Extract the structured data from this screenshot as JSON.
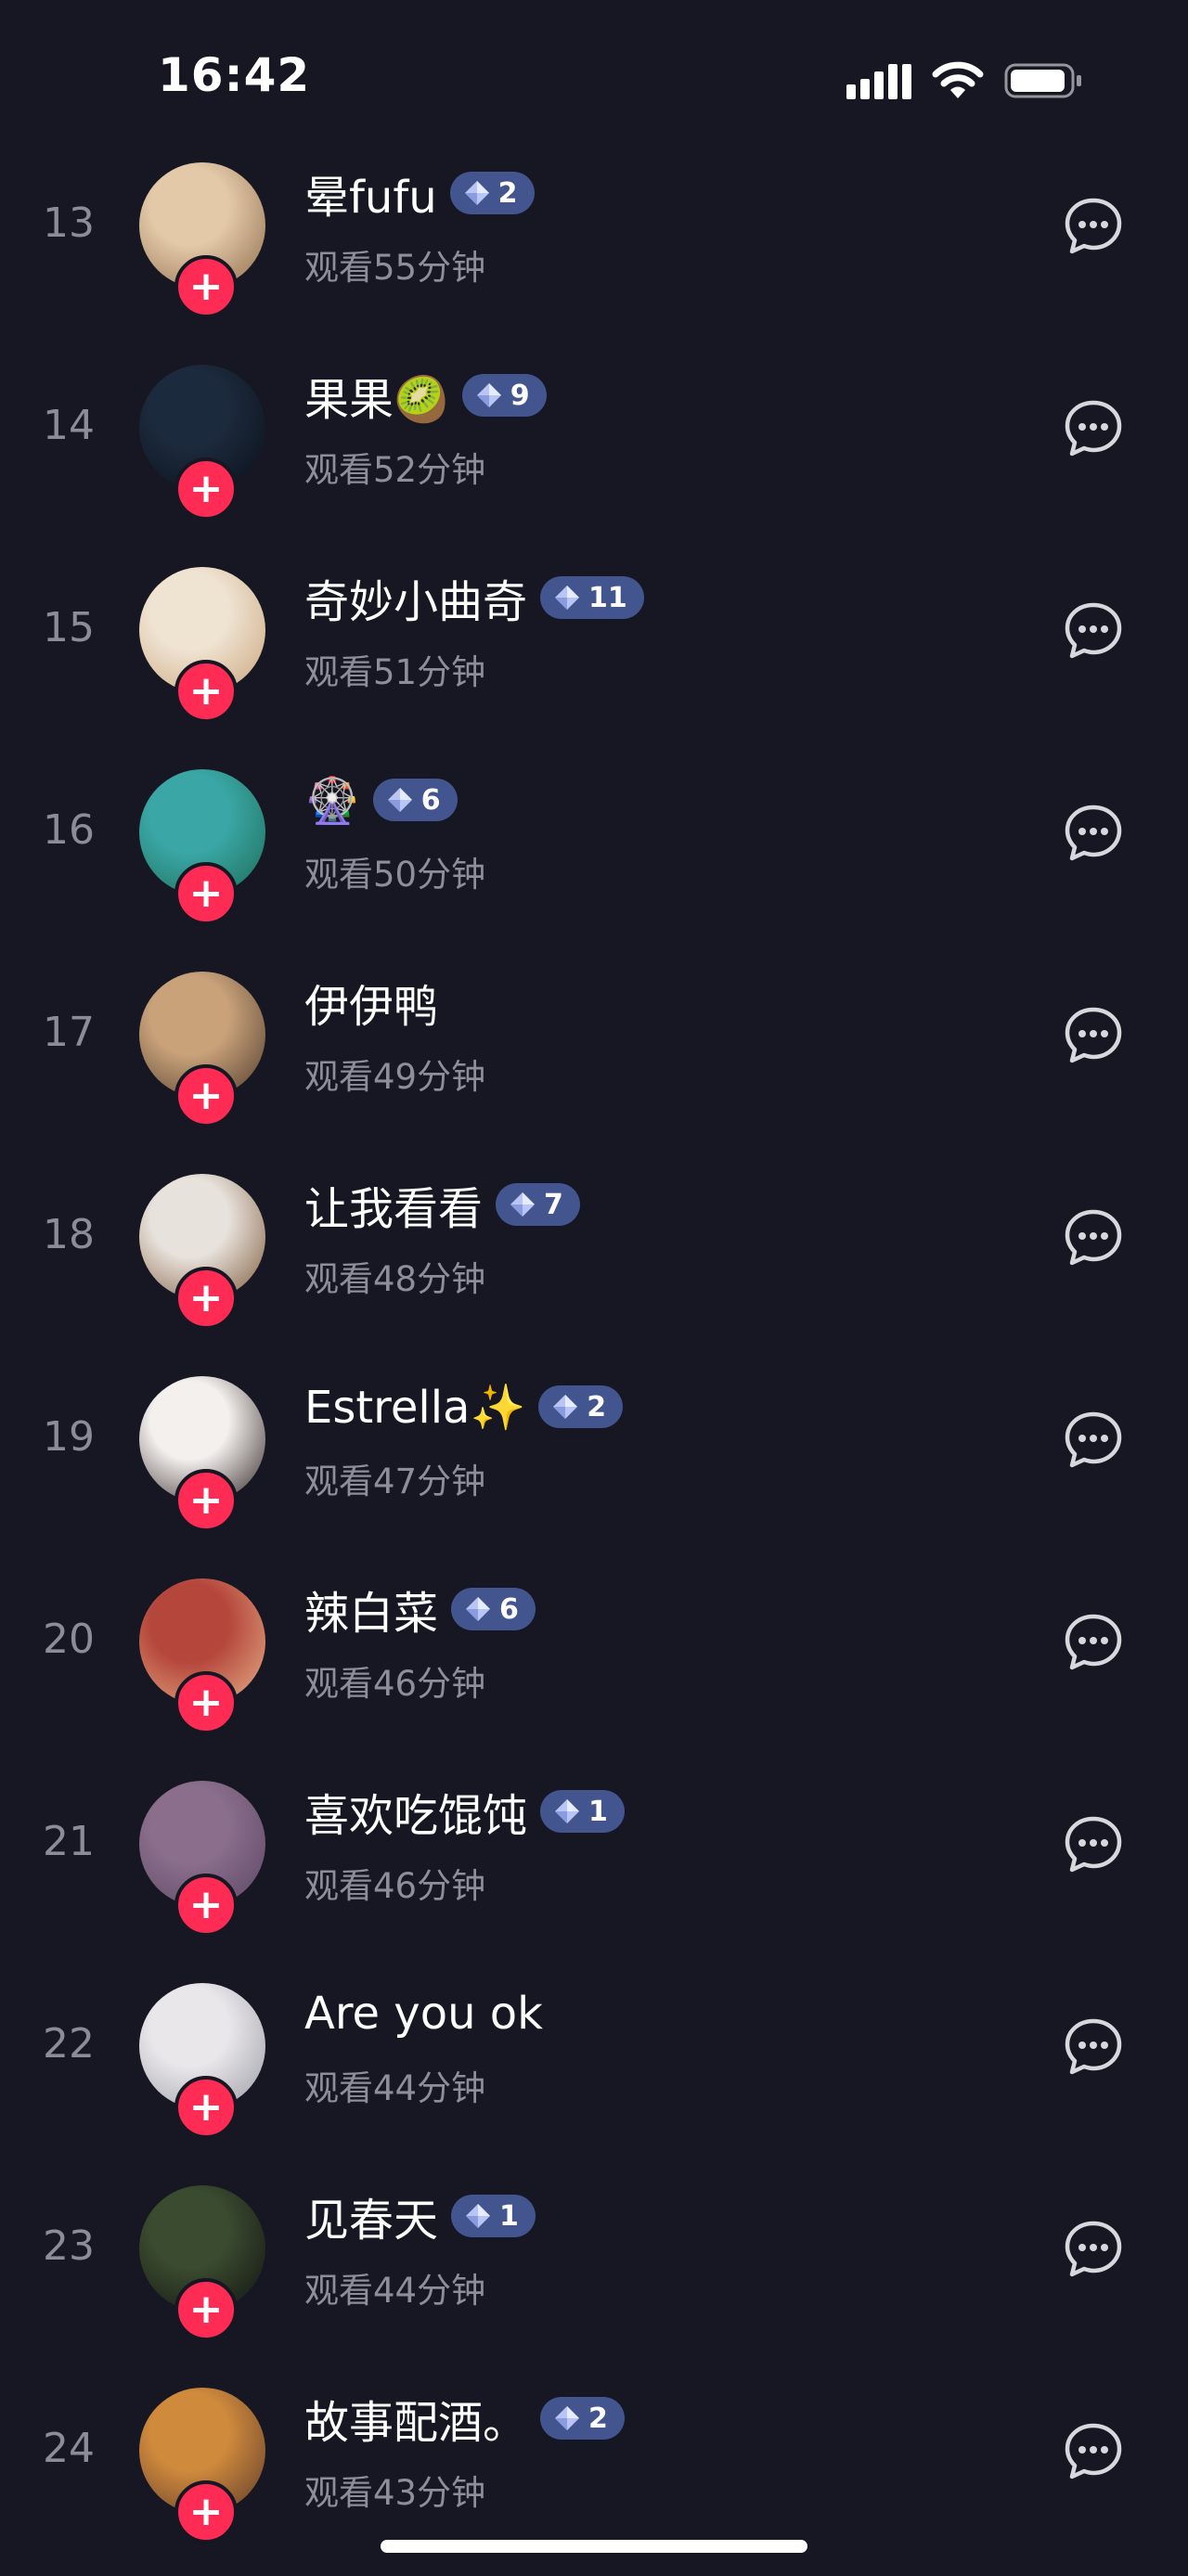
{
  "status_bar": {
    "time": "16:42"
  },
  "follow_icon": "+",
  "rows": [
    {
      "rank": "13",
      "name": "晕fufu",
      "level": "2",
      "watch": "观看55分钟",
      "avatar_colors": [
        "#e3c9a8",
        "#8c6a4a"
      ]
    },
    {
      "rank": "14",
      "name": "果果🥝",
      "level": "9",
      "watch": "观看52分钟",
      "avatar_colors": [
        "#1c2a3d",
        "#0a0f18"
      ]
    },
    {
      "rank": "15",
      "name": "奇妙小曲奇",
      "level": "11",
      "watch": "观看51分钟",
      "avatar_colors": [
        "#efe3d2",
        "#c9a47a"
      ]
    },
    {
      "rank": "16",
      "name": "🎡",
      "level": "6",
      "watch": "观看50分钟",
      "avatar_colors": [
        "#3aa7a6",
        "#1d6b55"
      ]
    },
    {
      "rank": "17",
      "name": "伊伊鸭",
      "level": "",
      "watch": "观看49分钟",
      "avatar_colors": [
        "#c9a27a",
        "#4d3a2c"
      ]
    },
    {
      "rank": "18",
      "name": "让我看看",
      "level": "7",
      "watch": "观看48分钟",
      "avatar_colors": [
        "#e8e2dc",
        "#7a5636"
      ]
    },
    {
      "rank": "19",
      "name": "Estrella✨",
      "level": "2",
      "watch": "观看47分钟",
      "avatar_colors": [
        "#f4f0ee",
        "#2c2222"
      ]
    },
    {
      "rank": "20",
      "name": "辣白菜",
      "level": "6",
      "watch": "观看46分钟",
      "avatar_colors": [
        "#b5463b",
        "#e6b48a"
      ]
    },
    {
      "rank": "21",
      "name": "喜欢吃馄饨",
      "level": "1",
      "watch": "观看46分钟",
      "avatar_colors": [
        "#8a6e8c",
        "#5a4763"
      ]
    },
    {
      "rank": "22",
      "name": "Are you ok",
      "level": "",
      "watch": "观看44分钟",
      "avatar_colors": [
        "#e9e7ea",
        "#9a9aa3"
      ]
    },
    {
      "rank": "23",
      "name": "见春天",
      "level": "1",
      "watch": "观看44分钟",
      "avatar_colors": [
        "#3a4b2f",
        "#111"
      ]
    },
    {
      "rank": "24",
      "name": "故事配酒。",
      "level": "2",
      "watch": "观看43分钟",
      "avatar_colors": [
        "#d08a3c",
        "#5a3a2c"
      ]
    }
  ]
}
